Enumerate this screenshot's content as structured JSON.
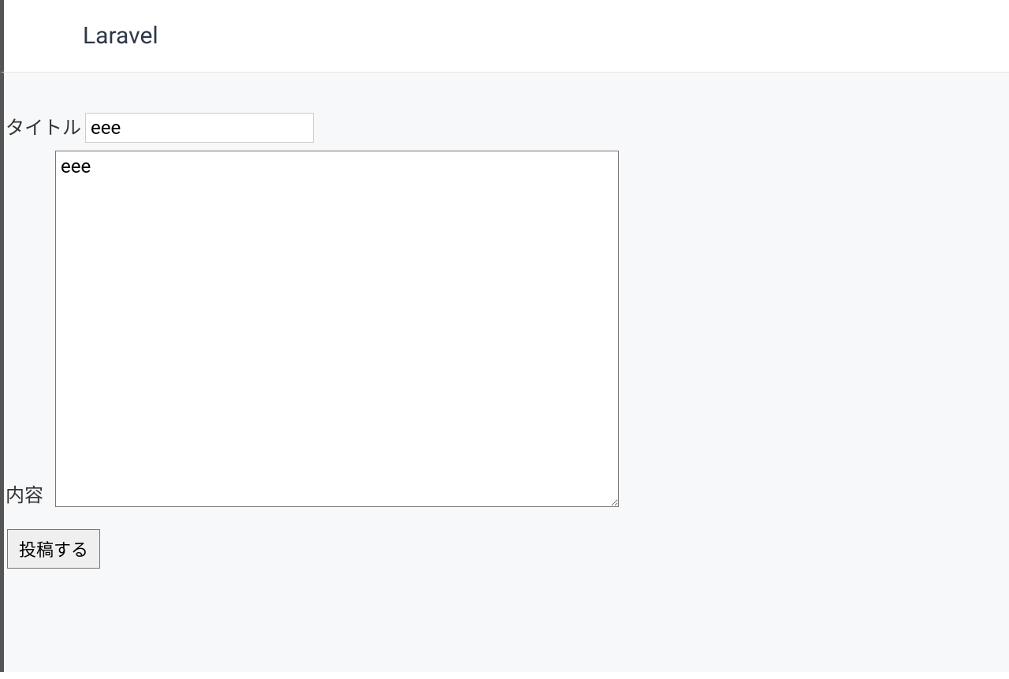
{
  "header": {
    "title": "Laravel"
  },
  "form": {
    "title_label": "タイトル",
    "title_value": "eee",
    "content_label": "内容",
    "content_value": "eee",
    "submit_label": "投稿する"
  }
}
